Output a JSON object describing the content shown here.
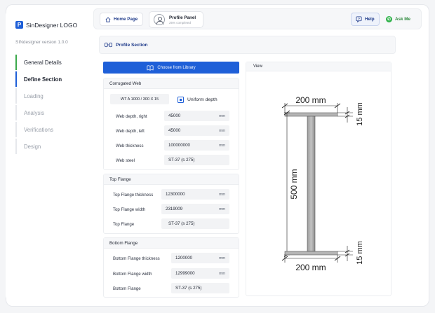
{
  "sidebar": {
    "logo_text": "SinDesigner LOGO",
    "version": "SINdesigner version 1.0.0",
    "items": [
      {
        "label": "General Details"
      },
      {
        "label": "Define Section"
      },
      {
        "label": "Loading"
      },
      {
        "label": "Analysis"
      },
      {
        "label": "Verifications"
      },
      {
        "label": "Design"
      }
    ]
  },
  "topbar": {
    "home_label": "Home Page",
    "profile_title": "Profile Panel",
    "profile_sub": "25% completed",
    "help_label": "Help",
    "ask_label": "Ask Me"
  },
  "section": {
    "title": "Profile Section"
  },
  "choose_label": "Choose from Library",
  "web": {
    "title": "Corrugated Web",
    "profile": "WT A 1000 / 300 X 15",
    "uniform_label": "Uniform depth",
    "uniform_checked": true,
    "rows": [
      {
        "label": "Web depth, right",
        "value": "45000",
        "unit": "mm"
      },
      {
        "label": "Web depth, left",
        "value": "45000",
        "unit": "mm"
      },
      {
        "label": "Web thickness",
        "value": "100000000",
        "unit": "mm"
      },
      {
        "label": "Web steel",
        "value": "ST-37 (s 275)",
        "unit": ""
      }
    ]
  },
  "top_flange": {
    "title": "Top Flange",
    "rows": [
      {
        "label": "Top Flange thickness",
        "value": "12300000",
        "unit": "mm"
      },
      {
        "label": "Top Flange width",
        "value": "2319009",
        "unit": "mm"
      },
      {
        "label": "Top Flange",
        "value": "ST-37 (s 275)",
        "unit": ""
      }
    ]
  },
  "bottom_flange": {
    "title": "Bottom Flange",
    "rows": [
      {
        "label": "Bottom Flange thickness",
        "value": "1200000",
        "unit": "mm"
      },
      {
        "label": "Bottom Flange width",
        "value": "12999000",
        "unit": "mm"
      },
      {
        "label": "Bottom Flange",
        "value": "ST-37 (s 275)",
        "unit": ""
      }
    ]
  },
  "view": {
    "title": "View",
    "top_width": "200 mm",
    "top_thickness": "15 mm",
    "height": "500 mm",
    "bottom_width": "200 mm",
    "bottom_thickness": "15 mm"
  },
  "colors": {
    "primary": "#1e5fd8",
    "accent_green": "#3ba94b",
    "whatsapp": "#2fb24a"
  }
}
